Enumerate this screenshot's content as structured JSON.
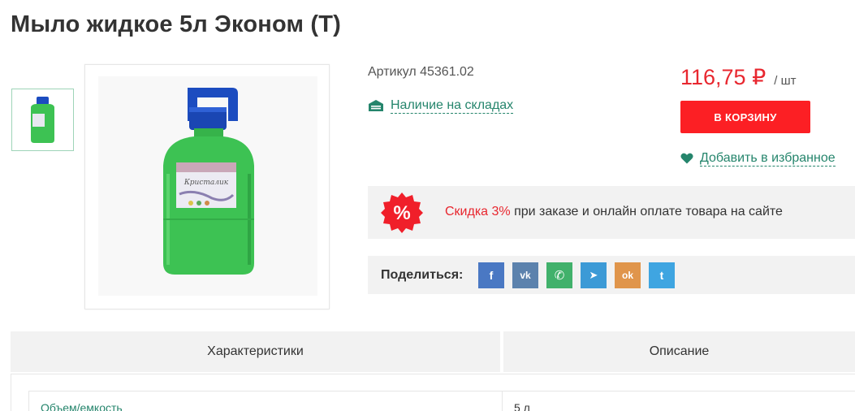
{
  "product": {
    "title": "Мыло жидкое 5л Эконом (Т)",
    "sku": "Артикул 45361.02",
    "stock_link": "Наличие на складах",
    "price": "116,75 ₽",
    "price_unit": "/ шт",
    "cart_button": "В КОРЗИНУ",
    "favorite_link": "Добавить в избранное",
    "bottle_label": "Кристалик"
  },
  "discount": {
    "badge": "%",
    "highlight": "Скидка 3%",
    "text": " при заказе и онлайн оплате товара на сайте"
  },
  "share": {
    "label": "Поделиться:",
    "networks": [
      {
        "icon": "facebook-icon",
        "glyph": "f",
        "color": "#4a78c3"
      },
      {
        "icon": "vk-icon",
        "glyph": "vk",
        "color": "#5c82ad"
      },
      {
        "icon": "whatsapp-icon",
        "glyph": "✆",
        "color": "#41b16b"
      },
      {
        "icon": "telegram-icon",
        "glyph": "➤",
        "color": "#3c9ad6"
      },
      {
        "icon": "odnoklassniki-icon",
        "glyph": "ok",
        "color": "#e0954b"
      },
      {
        "icon": "twitter-icon",
        "glyph": "t",
        "color": "#3fa5e1"
      }
    ]
  },
  "tabs": [
    {
      "label": "Характеристики"
    },
    {
      "label": "Описание"
    }
  ],
  "specs": [
    {
      "key": "Объем/емкость",
      "value": "5 л"
    }
  ],
  "colors": {
    "accent_green": "#25856c",
    "price_red": "#e8272f",
    "button_red": "#fc1f24",
    "bottle_green": "#3dc253",
    "cap_blue": "#1c4cc0"
  }
}
